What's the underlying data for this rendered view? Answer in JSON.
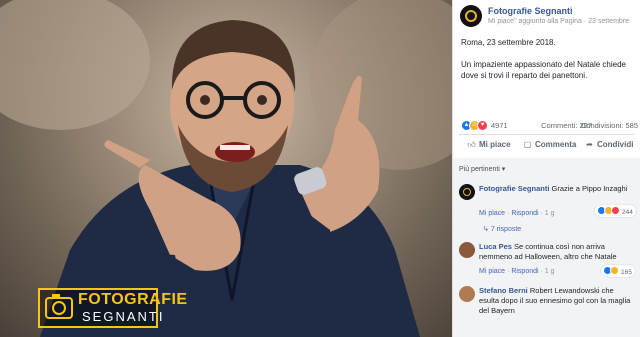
{
  "photo": {
    "watermark_line1": "FOTOGRAFIE",
    "watermark_line2": "SEGNANTI"
  },
  "post": {
    "page_name": "Fotografie Segnanti",
    "meta": "Mi piace\" aggiunto alla Pagina · 23 settembre",
    "date_line": "Roma, 23 settembre 2018.",
    "body": "Un impaziente appassionato del Natale chiede dove si trovi il reparto dei panettoni.",
    "reactions_count": "4971",
    "comments_count": "Commenti: 287",
    "shares_count": "Condivisioni: 585",
    "actions": {
      "like": "Mi piace",
      "comment": "Commenta",
      "share": "Condividi"
    }
  },
  "comments": {
    "filter_label": "Più pertinenti ▾",
    "items": [
      {
        "author": "Fotografie Segnanti",
        "text": "Grazie a Pippo Inzaghi",
        "like": "Mi piace",
        "reply": "Rispondi",
        "time": "1 g",
        "reactions": "244"
      },
      {
        "author": "Luca Pes",
        "text": "Se continua così non arriva nemmeno ad Halloween, altro che Natale",
        "like": "Mi piace",
        "reply": "Rispondi",
        "time": "1 g",
        "reactions": "165"
      },
      {
        "author": "Stefano Berni",
        "text": "Robert Lewandowski che esulta dopo il suo ennesimo gol con la maglia del Bayern"
      }
    ],
    "replies_link": "7 risposte"
  },
  "colors": {
    "link": "#365899",
    "accent": "#4267b2",
    "like_blue": "#1877f2",
    "haha_yellow": "#f7b125",
    "love_red": "#f33e58"
  }
}
